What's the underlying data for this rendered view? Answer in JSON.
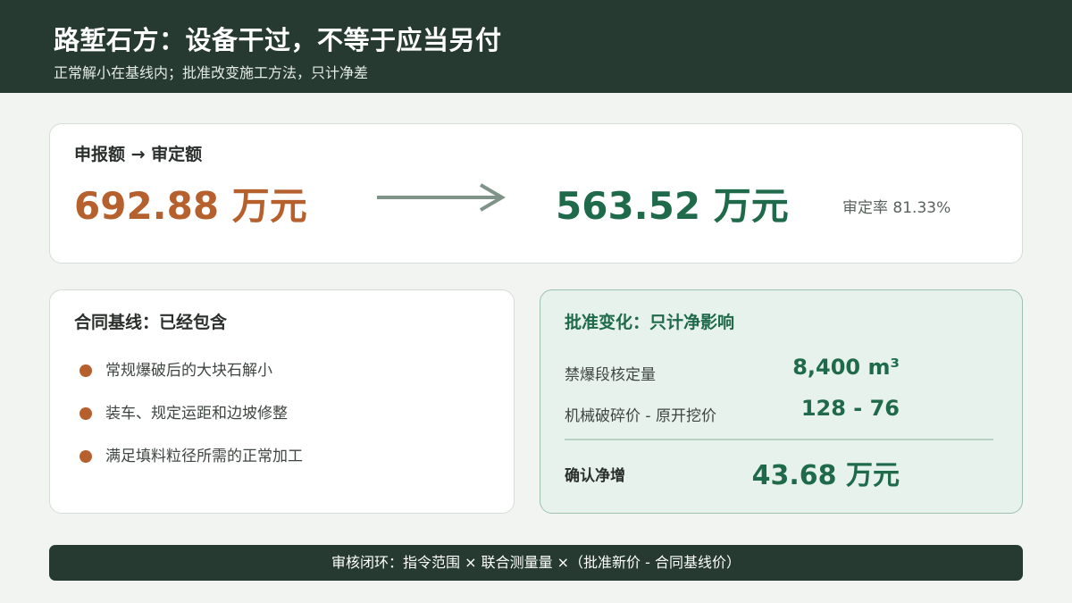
{
  "header": {
    "title": "路堑石方：设备干过，不等于应当另付",
    "subtitle": "正常解小在基线内；批准改变施工方法，只计净差"
  },
  "summary": {
    "label": "申报额 → 审定额",
    "claimed": "692.88 万元",
    "approved": "563.52 万元",
    "rate": "审定率 81.33%"
  },
  "baseline": {
    "heading": "合同基线：已经包含",
    "items": [
      "常规爆破后的大块石解小",
      "装车、规定运距和边坡修整",
      "满足填料粒径所需的正常加工"
    ]
  },
  "change": {
    "heading": "批准变化：只计净影响",
    "rows": [
      {
        "label": "禁爆段核定量",
        "value": "8,400 m³"
      },
      {
        "label": "机械破碎价 - 原开挖价",
        "value": "128 - 76"
      }
    ],
    "total_label": "确认净增",
    "total_value": "43.68 万元"
  },
  "footer": {
    "text": "审核闭环：指令范围 × 联合测量量 ×（批准新价 - 合同基线价）"
  },
  "colors": {
    "header_bg": "#263a31",
    "claimed": "#b5602d",
    "approved": "#1f6a4b",
    "panel_bg": "#e8f2ec"
  }
}
